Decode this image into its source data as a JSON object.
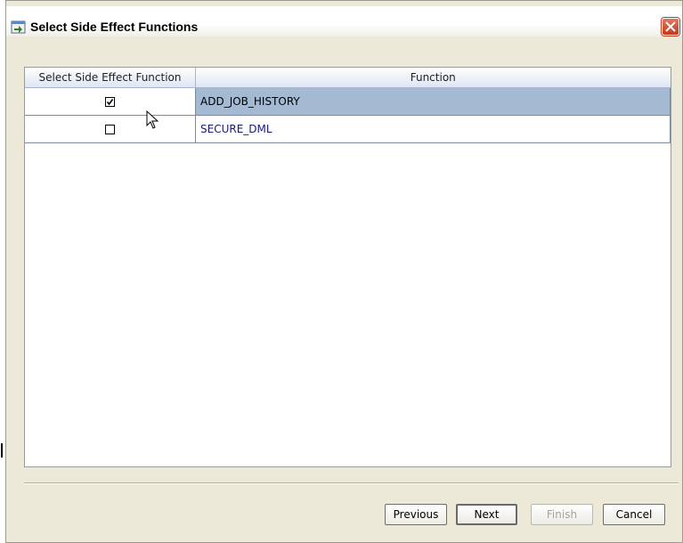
{
  "window": {
    "title": "Select Side Effect Functions"
  },
  "table": {
    "headers": [
      "Select Side Effect Function",
      "Function"
    ],
    "rows": [
      {
        "checked": true,
        "function": "ADD_JOB_HISTORY",
        "selected": true
      },
      {
        "checked": false,
        "function": "SECURE_DML",
        "selected": false
      }
    ]
  },
  "buttons": {
    "previous": "Previous",
    "next": "Next",
    "finish": "Finish",
    "cancel": "Cancel"
  },
  "icons": {
    "title": "wizard-icon",
    "close": "close-icon",
    "checkbox_checked": "checkmark-icon",
    "cursor": "mouse-pointer-icon"
  },
  "colors": {
    "selected_row": "#a3bad2",
    "header_bg": "#dde6f3",
    "close_button": "#c4381c",
    "link_text": "#1a1a7a"
  }
}
